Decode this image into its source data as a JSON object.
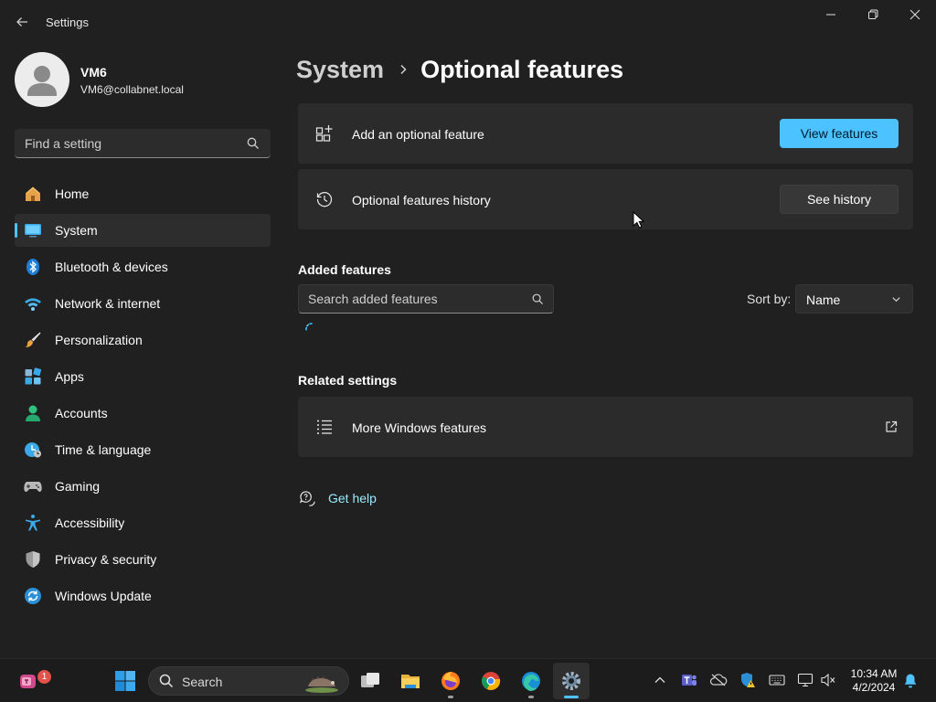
{
  "window": {
    "title": "Settings"
  },
  "profile": {
    "name": "VM6",
    "email": "VM6@collabnet.local"
  },
  "sidebar": {
    "search_placeholder": "Find a setting",
    "items": [
      {
        "label": "Home",
        "icon": "home-icon"
      },
      {
        "label": "System",
        "icon": "system-icon",
        "active": true
      },
      {
        "label": "Bluetooth & devices",
        "icon": "bluetooth-icon"
      },
      {
        "label": "Network & internet",
        "icon": "wifi-icon"
      },
      {
        "label": "Personalization",
        "icon": "brush-icon"
      },
      {
        "label": "Apps",
        "icon": "apps-icon"
      },
      {
        "label": "Accounts",
        "icon": "accounts-icon"
      },
      {
        "label": "Time & language",
        "icon": "clock-globe-icon"
      },
      {
        "label": "Gaming",
        "icon": "gamepad-icon"
      },
      {
        "label": "Accessibility",
        "icon": "accessibility-icon"
      },
      {
        "label": "Privacy & security",
        "icon": "shield-icon"
      },
      {
        "label": "Windows Update",
        "icon": "update-icon"
      }
    ]
  },
  "breadcrumb": {
    "parent": "System",
    "current": "Optional features"
  },
  "cards": {
    "add_feature": {
      "label": "Add an optional feature",
      "button": "View features"
    },
    "history": {
      "label": "Optional features history",
      "button": "See history"
    },
    "more_windows": {
      "label": "More Windows features"
    }
  },
  "added_features": {
    "title": "Added features",
    "search_placeholder": "Search added features",
    "sort_label": "Sort by:",
    "sort_value": "Name"
  },
  "related_settings": {
    "title": "Related settings"
  },
  "help": {
    "label": "Get help"
  },
  "taskbar": {
    "search_label": "Search",
    "notification_count": "1",
    "time": "10:34 AM",
    "date": "4/2/2024"
  },
  "colors": {
    "accent": "#4cc2ff",
    "background": "#202020",
    "card": "#2b2b2b",
    "link": "#99ebff"
  }
}
